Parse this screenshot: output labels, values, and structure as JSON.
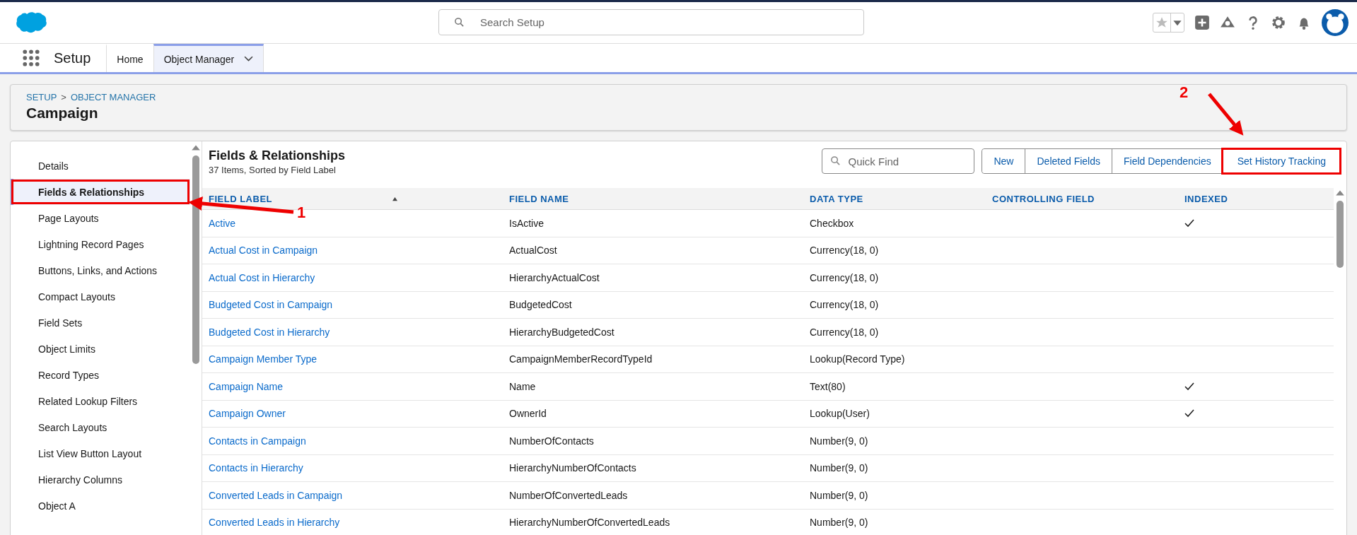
{
  "header": {
    "search": {
      "placeholder": "Search Setup"
    }
  },
  "nav": {
    "app_name": "Setup",
    "tabs": [
      {
        "label": "Home",
        "selected": false,
        "dropdown": false
      },
      {
        "label": "Object Manager",
        "selected": true,
        "dropdown": true
      }
    ]
  },
  "page_header": {
    "breadcrumb": [
      "SETUP",
      "OBJECT MANAGER"
    ],
    "separator": ">",
    "title": "Campaign"
  },
  "sidebar": {
    "items": [
      {
        "label": "Details",
        "selected": false,
        "outlined": false
      },
      {
        "label": "Fields & Relationships",
        "selected": true,
        "outlined": true
      },
      {
        "label": "Page Layouts",
        "selected": false,
        "outlined": false
      },
      {
        "label": "Lightning Record Pages",
        "selected": false,
        "outlined": false
      },
      {
        "label": "Buttons, Links, and Actions",
        "selected": false,
        "outlined": false
      },
      {
        "label": "Compact Layouts",
        "selected": false,
        "outlined": false
      },
      {
        "label": "Field Sets",
        "selected": false,
        "outlined": false
      },
      {
        "label": "Object Limits",
        "selected": false,
        "outlined": false
      },
      {
        "label": "Record Types",
        "selected": false,
        "outlined": false
      },
      {
        "label": "Related Lookup Filters",
        "selected": false,
        "outlined": false
      },
      {
        "label": "Search Layouts",
        "selected": false,
        "outlined": false
      },
      {
        "label": "List View Button Layout",
        "selected": false,
        "outlined": false
      },
      {
        "label": "Hierarchy Columns",
        "selected": false,
        "outlined": false
      },
      {
        "label": "Object A",
        "selected": false,
        "outlined": false
      }
    ]
  },
  "section": {
    "title": "Fields & Relationships",
    "subtitle": "37 Items, Sorted by Field Label",
    "quick_find": {
      "placeholder": "Quick Find"
    },
    "buttons": [
      {
        "label": "New",
        "outlined": false
      },
      {
        "label": "Deleted Fields",
        "outlined": false
      },
      {
        "label": "Field Dependencies",
        "outlined": false
      },
      {
        "label": "Set History Tracking",
        "outlined": true
      }
    ]
  },
  "table": {
    "columns": [
      {
        "label": "FIELD LABEL",
        "sorted": true
      },
      {
        "label": "FIELD NAME",
        "sorted": false
      },
      {
        "label": "DATA TYPE",
        "sorted": false
      },
      {
        "label": "CONTROLLING FIELD",
        "sorted": false
      },
      {
        "label": "INDEXED",
        "sorted": false
      }
    ],
    "rows": [
      {
        "label": "Active",
        "name": "IsActive",
        "type": "Checkbox",
        "indexed": true
      },
      {
        "label": "Actual Cost in Campaign",
        "name": "ActualCost",
        "type": "Currency(18, 0)",
        "indexed": false
      },
      {
        "label": "Actual Cost in Hierarchy",
        "name": "HierarchyActualCost",
        "type": "Currency(18, 0)",
        "indexed": false
      },
      {
        "label": "Budgeted Cost in Campaign",
        "name": "BudgetedCost",
        "type": "Currency(18, 0)",
        "indexed": false
      },
      {
        "label": "Budgeted Cost in Hierarchy",
        "name": "HierarchyBudgetedCost",
        "type": "Currency(18, 0)",
        "indexed": false
      },
      {
        "label": "Campaign Member Type",
        "name": "CampaignMemberRecordTypeId",
        "type": "Lookup(Record Type)",
        "indexed": false
      },
      {
        "label": "Campaign Name",
        "name": "Name",
        "type": "Text(80)",
        "indexed": true
      },
      {
        "label": "Campaign Owner",
        "name": "OwnerId",
        "type": "Lookup(User)",
        "indexed": true
      },
      {
        "label": "Contacts in Campaign",
        "name": "NumberOfContacts",
        "type": "Number(9, 0)",
        "indexed": false
      },
      {
        "label": "Contacts in Hierarchy",
        "name": "HierarchyNumberOfContacts",
        "type": "Number(9, 0)",
        "indexed": false
      },
      {
        "label": "Converted Leads in Campaign",
        "name": "NumberOfConvertedLeads",
        "type": "Number(9, 0)",
        "indexed": false
      },
      {
        "label": "Converted Leads in Hierarchy",
        "name": "HierarchyNumberOfConvertedLeads",
        "type": "Number(9, 0)",
        "indexed": false
      }
    ]
  },
  "annotations": [
    {
      "number": "1"
    },
    {
      "number": "2"
    }
  ]
}
